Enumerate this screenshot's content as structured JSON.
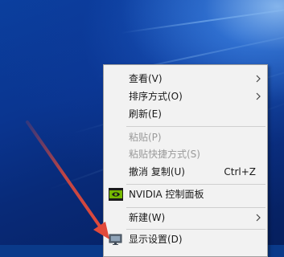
{
  "colors": {
    "menu_bg": "#f2f2f2",
    "disabled_text": "#9a9a9a",
    "annotation_arrow": "#e14a3b",
    "nvidia_green": "#76b900"
  },
  "context_menu": {
    "view": {
      "label": "查看(V)",
      "has_submenu": true,
      "icon": "chevron-right-icon"
    },
    "sort_by": {
      "label": "排序方式(O)",
      "has_submenu": true,
      "icon": "chevron-right-icon"
    },
    "refresh": {
      "label": "刷新(E)"
    },
    "paste": {
      "label": "粘贴(P)",
      "disabled": true
    },
    "paste_shortcut": {
      "label": "粘贴快捷方式(S)",
      "disabled": true
    },
    "undo_copy": {
      "label": "撤消 复制(U)",
      "shortcut": "Ctrl+Z"
    },
    "nvidia": {
      "label": "NVIDIA 控制面板",
      "icon": "nvidia-logo-icon"
    },
    "new": {
      "label": "新建(W)",
      "has_submenu": true,
      "icon": "chevron-right-icon"
    },
    "display_settings": {
      "label": "显示设置(D)",
      "icon": "display-settings-icon"
    }
  }
}
